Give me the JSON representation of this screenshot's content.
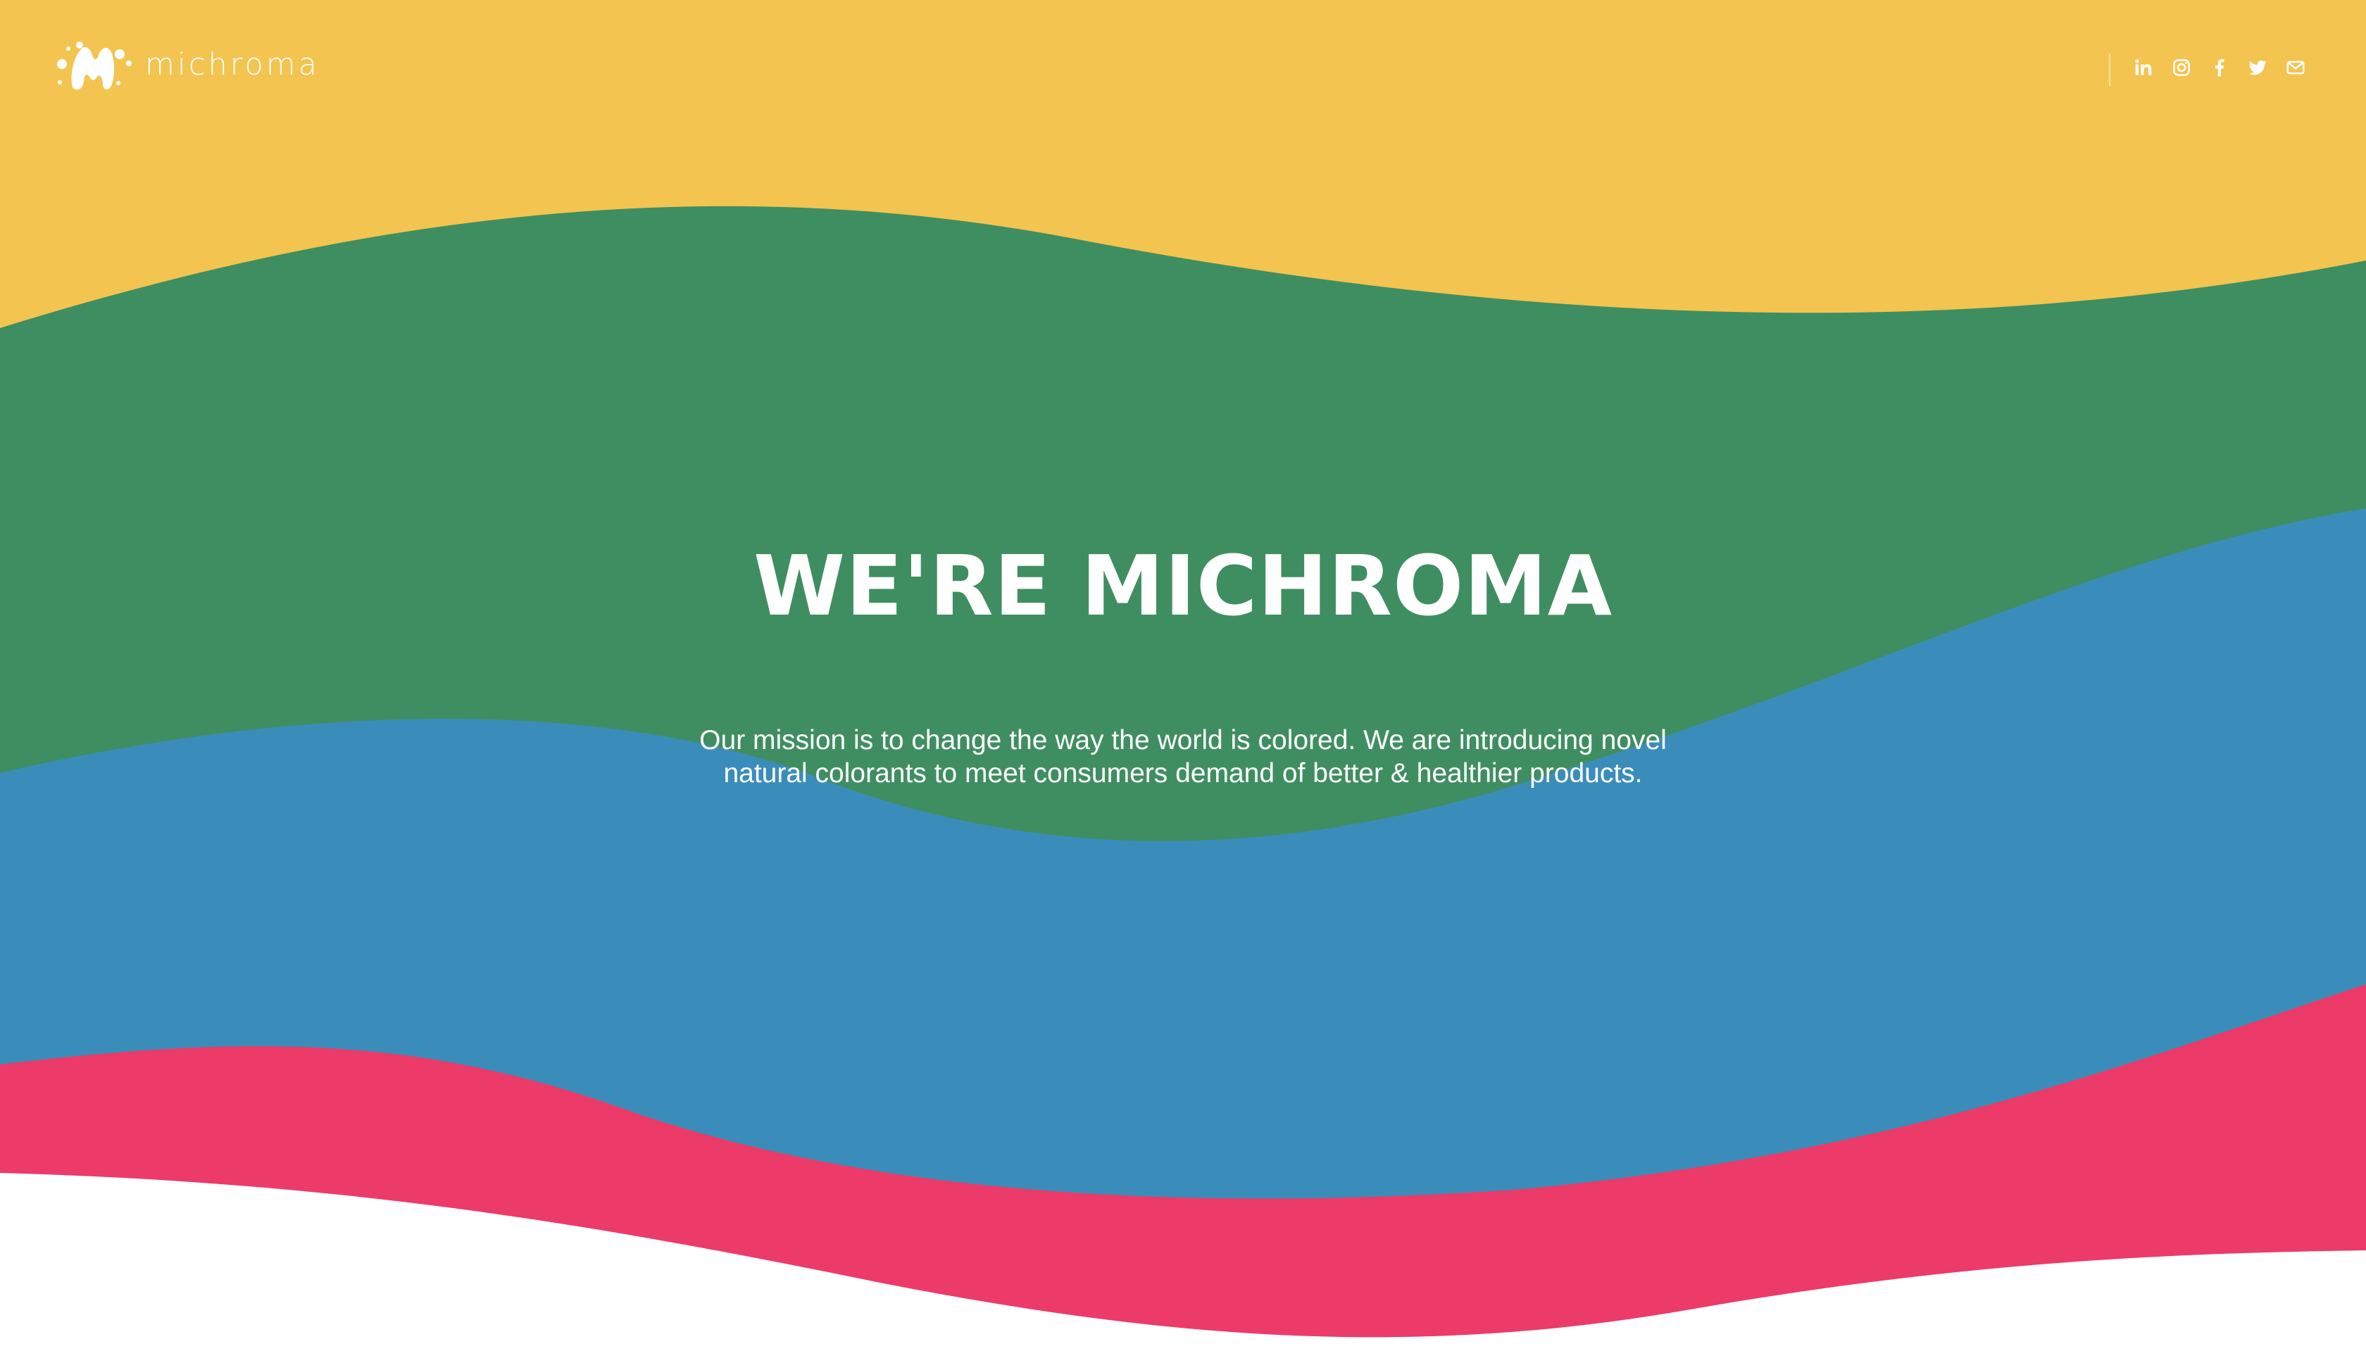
{
  "brand": {
    "name": "michroma"
  },
  "header": {
    "social_links": [
      {
        "icon": "linkedin-icon",
        "label": "in"
      },
      {
        "icon": "instagram-icon"
      },
      {
        "icon": "facebook-icon"
      },
      {
        "icon": "twitter-icon"
      },
      {
        "icon": "mail-icon"
      }
    ]
  },
  "hero": {
    "title": "WE'RE MICHROMA",
    "description": "Our mission is to change the way the world is colored. We are introducing novel natural colorants to meet consumers demand of better & healthier products."
  },
  "colors": {
    "yellow": "#F3C450",
    "green": "#3F8E61",
    "blue": "#3A8DBA",
    "pink": "#EC3B68",
    "white": "#FFFFFF"
  }
}
